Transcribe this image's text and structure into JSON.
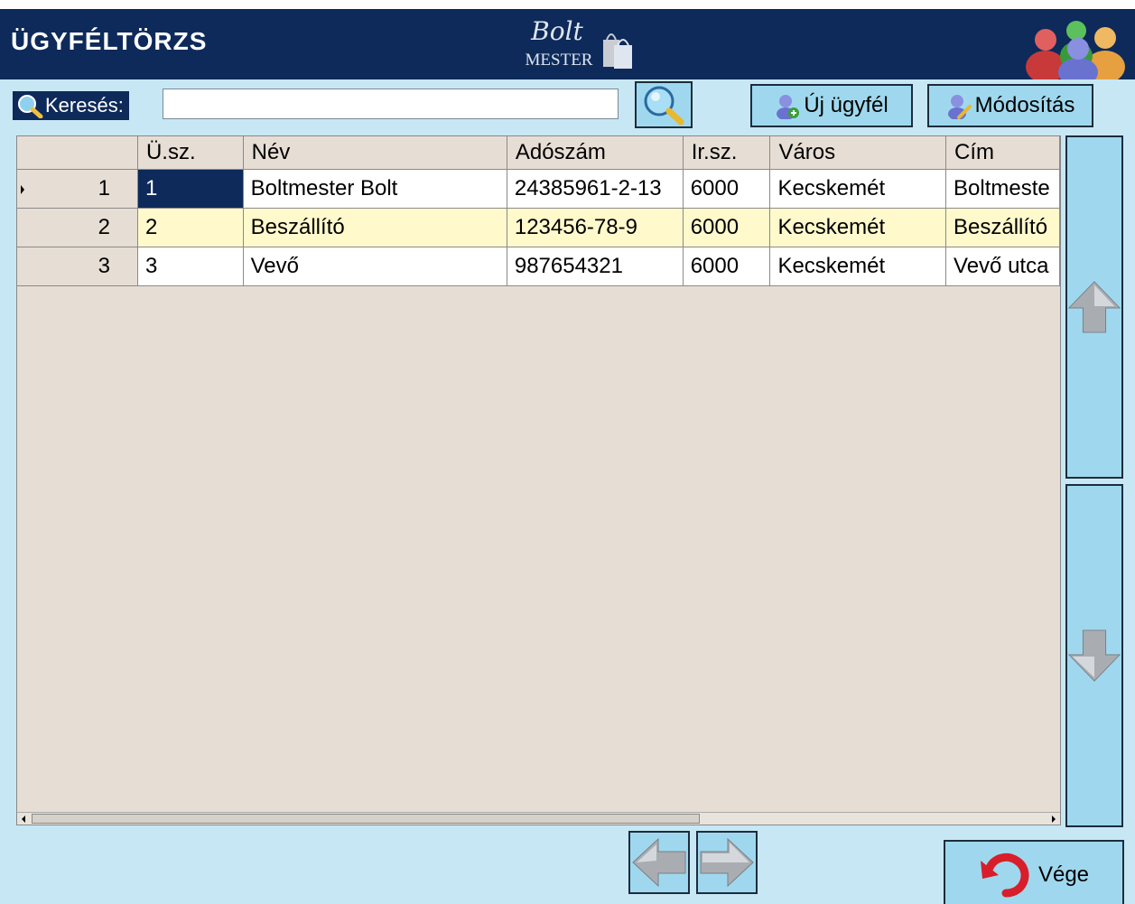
{
  "header": {
    "title": "ÜGYFÉLTÖRZS",
    "logo_top": "Bolt",
    "logo_bottom": "MESTER",
    "bg_color": "#0d2a5a"
  },
  "toolbar": {
    "search_label": "Keresés:",
    "search_value": "",
    "new_customer_label": "Új ügyfél",
    "modify_label": "Módosítás"
  },
  "table": {
    "columns": [
      "Ü.sz.",
      "Név",
      "Adószám",
      "Ir.sz.",
      "Város",
      "Cím"
    ],
    "rows": [
      {
        "row_number": "1",
        "cells": [
          "1",
          "Boltmester Bolt",
          "24385961-2-13",
          "6000",
          "Kecskemét",
          "Boltmeste"
        ]
      },
      {
        "row_number": "2",
        "cells": [
          "2",
          "Beszállító",
          "123456-78-9",
          "6000",
          "Kecskemét",
          "Beszállító"
        ]
      },
      {
        "row_number": "3",
        "cells": [
          "3",
          "Vevő",
          "987654321",
          "6000",
          "Kecskemét",
          "Vevő utca"
        ]
      }
    ],
    "selected_row": 1,
    "row_highlight_color": "#fff9cc",
    "selection_color": "#0d2a5a"
  },
  "footer": {
    "exit_label": "Vége"
  },
  "colors": {
    "panel_bg": "#c8e7f4",
    "button_bg": "#9fd8ee"
  }
}
